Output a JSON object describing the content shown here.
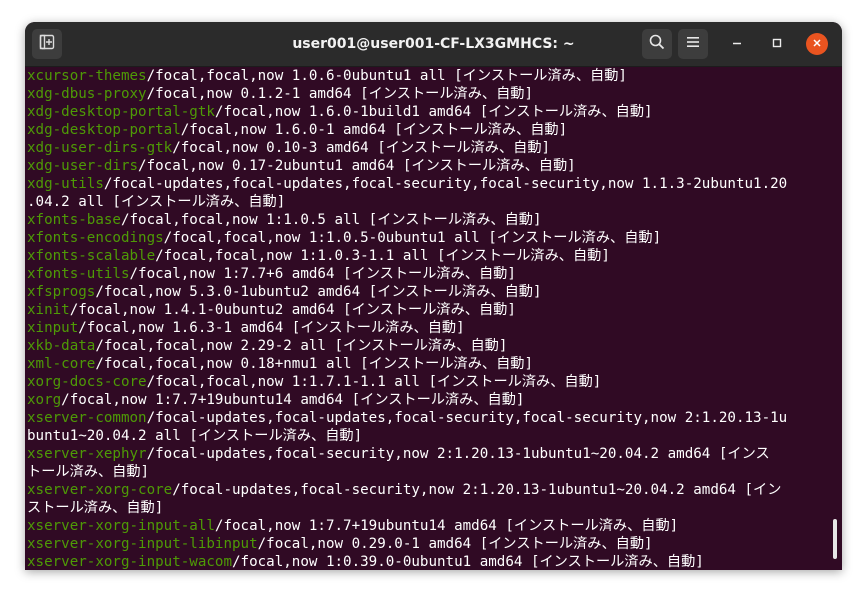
{
  "window": {
    "title": "user001@user001-CF-LX3GMHCS: ~",
    "buttons": {
      "new_tab_icon": "new-tab-icon",
      "search_icon": "search-icon",
      "menu_icon": "hamburger-menu-icon",
      "minimize_icon": "minimize-icon",
      "maximize_icon": "maximize-icon",
      "close_icon": "close-icon"
    }
  },
  "colors": {
    "terminal_bg": "#300a24",
    "package_name": "#4e9a06",
    "text": "#ffffff",
    "close_button": "#e95420"
  },
  "terminal": {
    "lines": [
      {
        "pkg": "xcursor-themes",
        "rest": "/focal,focal,now 1.0.6-0ubuntu1 all [インストール済み、自動]"
      },
      {
        "pkg": "xdg-dbus-proxy",
        "rest": "/focal,now 0.1.2-1 amd64 [インストール済み、自動]"
      },
      {
        "pkg": "xdg-desktop-portal-gtk",
        "rest": "/focal,now 1.6.0-1build1 amd64 [インストール済み、自動]"
      },
      {
        "pkg": "xdg-desktop-portal",
        "rest": "/focal,now 1.6.0-1 amd64 [インストール済み、自動]"
      },
      {
        "pkg": "xdg-user-dirs-gtk",
        "rest": "/focal,now 0.10-3 amd64 [インストール済み、自動]"
      },
      {
        "pkg": "xdg-user-dirs",
        "rest": "/focal,now 0.17-2ubuntu1 amd64 [インストール済み、自動]"
      },
      {
        "pkg": "xdg-utils",
        "rest": "/focal-updates,focal-updates,focal-security,focal-security,now 1.1.3-2ubuntu1.20"
      },
      {
        "pkg": "",
        "rest": ".04.2 all [インストール済み、自動]"
      },
      {
        "pkg": "xfonts-base",
        "rest": "/focal,focal,now 1:1.0.5 all [インストール済み、自動]"
      },
      {
        "pkg": "xfonts-encodings",
        "rest": "/focal,focal,now 1:1.0.5-0ubuntu1 all [インストール済み、自動]"
      },
      {
        "pkg": "xfonts-scalable",
        "rest": "/focal,focal,now 1:1.0.3-1.1 all [インストール済み、自動]"
      },
      {
        "pkg": "xfonts-utils",
        "rest": "/focal,now 1:7.7+6 amd64 [インストール済み、自動]"
      },
      {
        "pkg": "xfsprogs",
        "rest": "/focal,now 5.3.0-1ubuntu2 amd64 [インストール済み、自動]"
      },
      {
        "pkg": "xinit",
        "rest": "/focal,now 1.4.1-0ubuntu2 amd64 [インストール済み、自動]"
      },
      {
        "pkg": "xinput",
        "rest": "/focal,now 1.6.3-1 amd64 [インストール済み、自動]"
      },
      {
        "pkg": "xkb-data",
        "rest": "/focal,focal,now 2.29-2 all [インストール済み、自動]"
      },
      {
        "pkg": "xml-core",
        "rest": "/focal,focal,now 0.18+nmu1 all [インストール済み、自動]"
      },
      {
        "pkg": "xorg-docs-core",
        "rest": "/focal,focal,now 1:1.7.1-1.1 all [インストール済み、自動]"
      },
      {
        "pkg": "xorg",
        "rest": "/focal,now 1:7.7+19ubuntu14 amd64 [インストール済み、自動]"
      },
      {
        "pkg": "xserver-common",
        "rest": "/focal-updates,focal-updates,focal-security,focal-security,now 2:1.20.13-1u"
      },
      {
        "pkg": "",
        "rest": "buntu1~20.04.2 all [インストール済み、自動]"
      },
      {
        "pkg": "xserver-xephyr",
        "rest": "/focal-updates,focal-security,now 2:1.20.13-1ubuntu1~20.04.2 amd64 [インス"
      },
      {
        "pkg": "",
        "rest": "トール済み、自動]"
      },
      {
        "pkg": "xserver-xorg-core",
        "rest": "/focal-updates,focal-security,now 2:1.20.13-1ubuntu1~20.04.2 amd64 [イン"
      },
      {
        "pkg": "",
        "rest": "ストール済み、自動]"
      },
      {
        "pkg": "xserver-xorg-input-all",
        "rest": "/focal,now 1:7.7+19ubuntu14 amd64 [インストール済み、自動]"
      },
      {
        "pkg": "xserver-xorg-input-libinput",
        "rest": "/focal,now 0.29.0-1 amd64 [インストール済み、自動]"
      },
      {
        "pkg": "xserver-xorg-input-wacom",
        "rest": "/focal,now 1:0.39.0-0ubuntu1 amd64 [インストール済み、自動]"
      }
    ]
  }
}
